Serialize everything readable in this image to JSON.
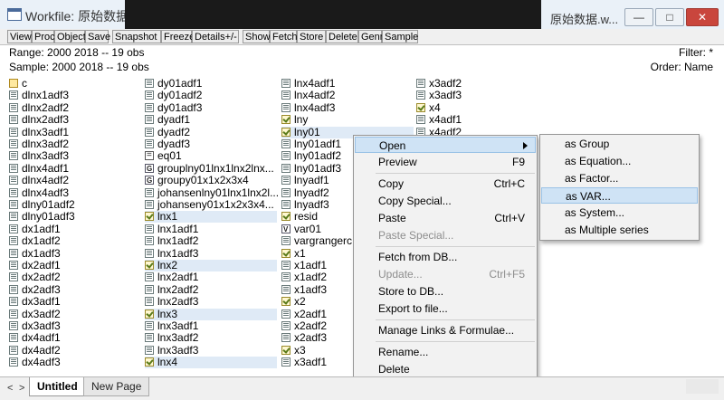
{
  "window": {
    "title": "Workfile: 原始数据",
    "title_right": "原始数据.w...",
    "controls": {
      "minimize": "—",
      "maximize": "□",
      "close": "✕"
    }
  },
  "toolbar": {
    "buttons": [
      "View",
      "Proc",
      "Object",
      "Save",
      "Snapshot",
      "Freeze",
      "Details+/-",
      "Show",
      "Fetch",
      "Store",
      "Delete",
      "Genr",
      "Sample"
    ]
  },
  "info": {
    "range": "Range:  2000 2018   --    19 obs",
    "sample": "Sample: 2000 2018   --    19 obs",
    "filter": "Filter: *",
    "order": "Order: Name"
  },
  "columns": [
    [
      {
        "name": "c",
        "icon": "alpha-icon"
      },
      {
        "name": "dlnx1adf3",
        "icon": "series-icon"
      },
      {
        "name": "dlnx2adf2",
        "icon": "series-icon"
      },
      {
        "name": "dlnx2adf3",
        "icon": "series-icon"
      },
      {
        "name": "dlnx3adf1",
        "icon": "series-icon"
      },
      {
        "name": "dlnx3adf2",
        "icon": "series-icon"
      },
      {
        "name": "dlnx3adf3",
        "icon": "series-icon"
      },
      {
        "name": "dlnx4adf1",
        "icon": "series-icon"
      },
      {
        "name": "dlnx4adf2",
        "icon": "series-icon"
      },
      {
        "name": "dlnx4adf3",
        "icon": "series-icon"
      },
      {
        "name": "dlny01adf2",
        "icon": "series-icon"
      },
      {
        "name": "dlny01adf3",
        "icon": "series-icon"
      },
      {
        "name": "dx1adf1",
        "icon": "series-icon"
      },
      {
        "name": "dx1adf2",
        "icon": "series-icon"
      },
      {
        "name": "dx1adf3",
        "icon": "series-icon"
      },
      {
        "name": "dx2adf1",
        "icon": "series-icon"
      },
      {
        "name": "dx2adf2",
        "icon": "series-icon"
      },
      {
        "name": "dx2adf3",
        "icon": "series-icon"
      },
      {
        "name": "dx3adf1",
        "icon": "series-icon"
      },
      {
        "name": "dx3adf2",
        "icon": "series-icon"
      },
      {
        "name": "dx3adf3",
        "icon": "series-icon"
      },
      {
        "name": "dx4adf1",
        "icon": "series-icon"
      },
      {
        "name": "dx4adf2",
        "icon": "series-icon"
      },
      {
        "name": "dx4adf3",
        "icon": "series-icon"
      }
    ],
    [
      {
        "name": "dy01adf1",
        "icon": "series-icon"
      },
      {
        "name": "dy01adf2",
        "icon": "series-icon"
      },
      {
        "name": "dy01adf3",
        "icon": "series-icon"
      },
      {
        "name": "dyadf1",
        "icon": "series-icon"
      },
      {
        "name": "dyadf2",
        "icon": "series-icon"
      },
      {
        "name": "dyadf3",
        "icon": "series-icon"
      },
      {
        "name": "eq01",
        "icon": "equation-icon"
      },
      {
        "name": "grouplny01lnx1lnx2lnx...",
        "icon": "group-icon"
      },
      {
        "name": "groupy01x1x2x3x4",
        "icon": "group-icon"
      },
      {
        "name": "johansenlny01lnx1lnx2l...",
        "icon": "series-icon"
      },
      {
        "name": "johanseny01x1x2x3x4...",
        "icon": "series-icon"
      },
      {
        "name": "lnx1",
        "icon": "check-icon",
        "hl": true
      },
      {
        "name": "lnx1adf1",
        "icon": "series-icon"
      },
      {
        "name": "lnx1adf2",
        "icon": "series-icon"
      },
      {
        "name": "lnx1adf3",
        "icon": "series-icon"
      },
      {
        "name": "lnx2",
        "icon": "check-icon",
        "hl": true
      },
      {
        "name": "lnx2adf1",
        "icon": "series-icon"
      },
      {
        "name": "lnx2adf2",
        "icon": "series-icon"
      },
      {
        "name": "lnx2adf3",
        "icon": "series-icon"
      },
      {
        "name": "lnx3",
        "icon": "check-icon",
        "hl": true
      },
      {
        "name": "lnx3adf1",
        "icon": "series-icon"
      },
      {
        "name": "lnx3adf2",
        "icon": "series-icon"
      },
      {
        "name": "lnx3adf3",
        "icon": "series-icon"
      },
      {
        "name": "lnx4",
        "icon": "check-icon",
        "hl": true
      }
    ],
    [
      {
        "name": "lnx4adf1",
        "icon": "series-icon"
      },
      {
        "name": "lnx4adf2",
        "icon": "series-icon"
      },
      {
        "name": "lnx4adf3",
        "icon": "series-icon"
      },
      {
        "name": "lny",
        "icon": "check-icon"
      },
      {
        "name": "lny01",
        "icon": "check-icon",
        "hl": true
      },
      {
        "name": "lny01adf1",
        "icon": "series-icon"
      },
      {
        "name": "lny01adf2",
        "icon": "series-icon"
      },
      {
        "name": "lny01adf3",
        "icon": "series-icon"
      },
      {
        "name": "lnyadf1",
        "icon": "series-icon"
      },
      {
        "name": "lnyadf2",
        "icon": "series-icon"
      },
      {
        "name": "lnyadf3",
        "icon": "series-icon"
      },
      {
        "name": "resid",
        "icon": "check-icon"
      },
      {
        "name": "var01",
        "icon": "var-icon"
      },
      {
        "name": "vargrangerc",
        "icon": "series-icon"
      },
      {
        "name": "x1",
        "icon": "check-icon"
      },
      {
        "name": "x1adf1",
        "icon": "series-icon"
      },
      {
        "name": "x1adf2",
        "icon": "series-icon"
      },
      {
        "name": "x1adf3",
        "icon": "series-icon"
      },
      {
        "name": "x2",
        "icon": "check-icon"
      },
      {
        "name": "x2adf1",
        "icon": "series-icon"
      },
      {
        "name": "x2adf2",
        "icon": "series-icon"
      },
      {
        "name": "x2adf3",
        "icon": "series-icon"
      },
      {
        "name": "x3",
        "icon": "check-icon"
      },
      {
        "name": "x3adf1",
        "icon": "series-icon"
      }
    ],
    [
      {
        "name": "x3adf2",
        "icon": "series-icon"
      },
      {
        "name": "x3adf3",
        "icon": "series-icon"
      },
      {
        "name": "x4",
        "icon": "check-icon"
      },
      {
        "name": "x4adf1",
        "icon": "series-icon"
      },
      {
        "name": "x4adf2",
        "icon": "series-icon"
      }
    ]
  ],
  "context_menu": {
    "items": [
      {
        "label": "Open",
        "shortcut": "",
        "disabled": false,
        "active": true,
        "submenu": true
      },
      {
        "label": "Preview",
        "shortcut": "F9",
        "disabled": false
      },
      {
        "sep": true
      },
      {
        "label": "Copy",
        "shortcut": "Ctrl+C",
        "disabled": false
      },
      {
        "label": "Copy Special...",
        "shortcut": "",
        "disabled": false
      },
      {
        "label": "Paste",
        "shortcut": "Ctrl+V",
        "disabled": false
      },
      {
        "label": "Paste Special...",
        "shortcut": "",
        "disabled": true
      },
      {
        "sep": true
      },
      {
        "label": "Fetch from DB...",
        "shortcut": "",
        "disabled": false
      },
      {
        "label": "Update...",
        "shortcut": "Ctrl+F5",
        "disabled": true
      },
      {
        "label": "Store to DB...",
        "shortcut": "",
        "disabled": false
      },
      {
        "label": "Export to file...",
        "shortcut": "",
        "disabled": false
      },
      {
        "sep": true
      },
      {
        "label": "Manage Links & Formulae...",
        "shortcut": "",
        "disabled": false
      },
      {
        "sep": true
      },
      {
        "label": "Rename...",
        "shortcut": "",
        "disabled": false
      },
      {
        "label": "Delete",
        "shortcut": "",
        "disabled": false
      }
    ]
  },
  "submenu": {
    "items": [
      {
        "label": "as Group",
        "active": false
      },
      {
        "label": "as Equation...",
        "active": false
      },
      {
        "label": "as Factor...",
        "active": false
      },
      {
        "label": "as VAR...",
        "active": true
      },
      {
        "label": "as System...",
        "active": false
      },
      {
        "label": "as Multiple series",
        "active": false
      }
    ]
  },
  "bottom": {
    "nav_prev": "<",
    "nav_next": ">",
    "tabs": [
      {
        "label": "Untitled",
        "active": true
      },
      {
        "label": "New Page",
        "active": false
      }
    ]
  }
}
